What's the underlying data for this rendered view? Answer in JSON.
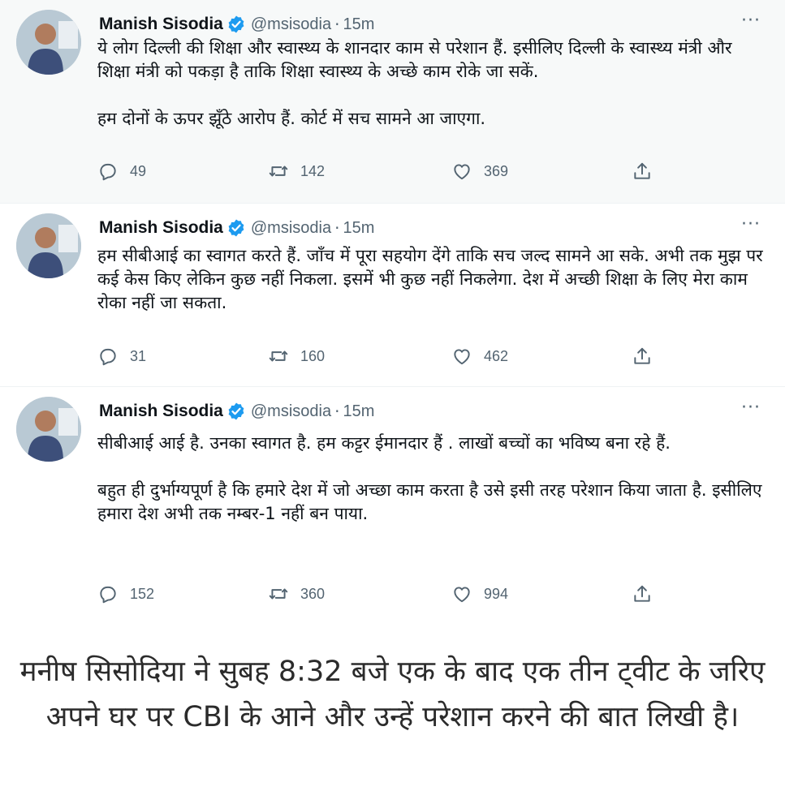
{
  "tweets": [
    {
      "author": {
        "name": "Manish Sisodia",
        "handle": "@msisodia",
        "separator": "·",
        "time": "15m"
      },
      "paragraphs": [
        "ये लोग दिल्ली की शिक्षा और स्वास्थ्य के शानदार काम से परेशान हैं. इसीलिए दिल्ली के स्वास्थ्य मंत्री और शिक्षा मंत्री को पकड़ा है ताकि शिक्षा स्वास्थ्य के अच्छे काम रोके जा सकें.",
        "हम दोनों के ऊपर झूँठे आरोप हैं. कोर्ट में सच सामने आ जाएगा."
      ],
      "replies": "49",
      "retweets": "142",
      "likes": "369"
    },
    {
      "author": {
        "name": "Manish Sisodia",
        "handle": "@msisodia",
        "separator": "·",
        "time": "15m"
      },
      "paragraphs": [
        "हम सीबीआई का स्वागत करते हैं. जाँच में पूरा सहयोग देंगे ताकि सच जल्द सामने आ सके. अभी तक मुझ पर कई केस किए लेकिन कुछ नहीं निकला. इसमें भी कुछ नहीं निकलेगा. देश में अच्छी शिक्षा के लिए मेरा काम रोका नहीं जा सकता."
      ],
      "replies": "31",
      "retweets": "160",
      "likes": "462"
    },
    {
      "author": {
        "name": "Manish Sisodia",
        "handle": "@msisodia",
        "separator": "·",
        "time": "15m"
      },
      "paragraphs": [
        "सीबीआई आई है. उनका स्वागत है. हम कट्टर ईमानदार हैं . लाखों बच्चों का भविष्य बना रहे हैं.",
        "बहुत ही दुर्भाग्यपूर्ण है कि हमारे देश में जो अच्छा काम करता है उसे इसी तरह परेशान किया जाता है. इसीलिए हमारा देश अभी तक नम्बर-1 नहीं बन पाया."
      ],
      "replies": "152",
      "retweets": "360",
      "likes": "994"
    }
  ],
  "more_label": "···",
  "caption": "मनीष सिसोदिया ने सुबह 8:32 बजे एक के बाद एक तीन ट्वीट के जरिए अपने घर पर CBI के आने और उन्हें परेशान करने की बात लिखी है।",
  "colors": {
    "verified": "#1d9bf0",
    "muted_text": "#536471",
    "text": "#0f1419",
    "highlight_bg": "#f7f9f9"
  },
  "icons": [
    "verified-badge-icon",
    "more-icon",
    "reply-icon",
    "retweet-icon",
    "like-icon",
    "share-icon"
  ]
}
